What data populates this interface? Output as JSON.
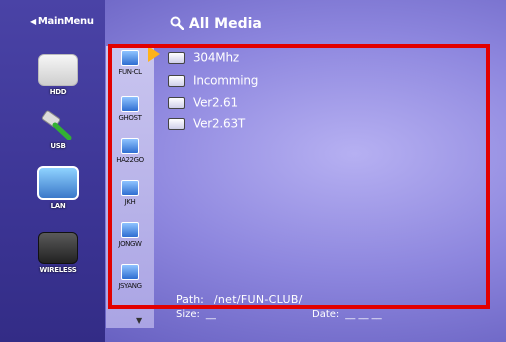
{
  "nav": {
    "back_label": "MainMenu"
  },
  "header": {
    "title": "All Media",
    "icon": "magnifier-icon"
  },
  "devices": [
    {
      "label": "HDD",
      "icon": "hdd-icon"
    },
    {
      "label": "USB",
      "icon": "usb-icon"
    },
    {
      "label": "LAN",
      "icon": "lan-icon"
    },
    {
      "label": "WIRELESS",
      "icon": "wireless-icon"
    }
  ],
  "shares": [
    {
      "label": "FUN-CL"
    },
    {
      "label": "GHOST"
    },
    {
      "label": "HA22GO"
    },
    {
      "label": "JKH"
    },
    {
      "label": "JONGW"
    },
    {
      "label": "JSYANG"
    }
  ],
  "files": [
    {
      "name": "304Mhz",
      "selected": true
    },
    {
      "name": "Incomming"
    },
    {
      "name": "Ver2.61"
    },
    {
      "name": "Ver2.63T"
    }
  ],
  "info": {
    "path_label": "Path:",
    "path_value": "/net/FUN-CLUB/",
    "size_label": "Size:",
    "size_value": "__",
    "date_label": "Date:",
    "date_value": "__ __ __"
  },
  "colors": {
    "highlight_frame": "#e20000",
    "selection_arrow": "#ffb21a"
  }
}
